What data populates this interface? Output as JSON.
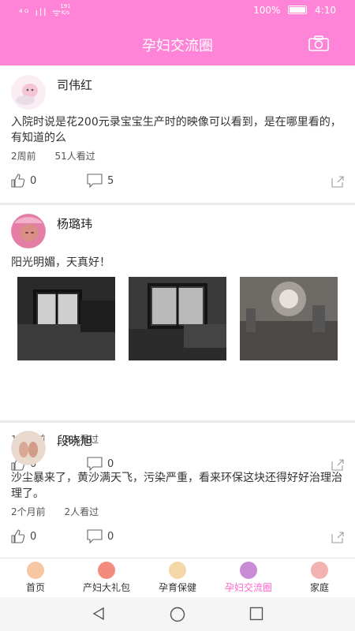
{
  "statusbar": {
    "signal": "⁴ᴳ ıll ᯤ",
    "speed": "191 K/s",
    "battery": "100%",
    "time": "4:10"
  },
  "header": {
    "title": "孕妇交流圈"
  },
  "posts": [
    {
      "author": "司伟红",
      "text": "入院时说是花200元录宝宝生产时的映像可以看到，是在哪里看的，有知道的么",
      "time": "2周前",
      "views": "51人看过",
      "likes": "0",
      "comments": "5"
    },
    {
      "author": "杨璐玮",
      "text": "阳光明媚，天真好！",
      "time": "1个月前",
      "views": "8人看过",
      "likes": "0",
      "comments": "0"
    },
    {
      "author": "段晓旭",
      "text": "沙尘暴来了，黄沙满天飞，污染严重，看来环保这块还得好好治理治理了。",
      "time": "2个月前",
      "views": "2人看过",
      "likes": "0",
      "comments": "0"
    }
  ],
  "tabs": [
    {
      "label": "首页",
      "icon": "home-icon",
      "active": false
    },
    {
      "label": "产妇大礼包",
      "icon": "gift-icon",
      "active": false
    },
    {
      "label": "孕育保健",
      "icon": "pregnant-icon",
      "active": false
    },
    {
      "label": "孕妇交流圈",
      "icon": "community-icon",
      "active": true
    },
    {
      "label": "家庭",
      "icon": "family-icon",
      "active": false
    }
  ],
  "colors": {
    "accent": "#ff83d6",
    "active_tab": "#ff66cc"
  }
}
